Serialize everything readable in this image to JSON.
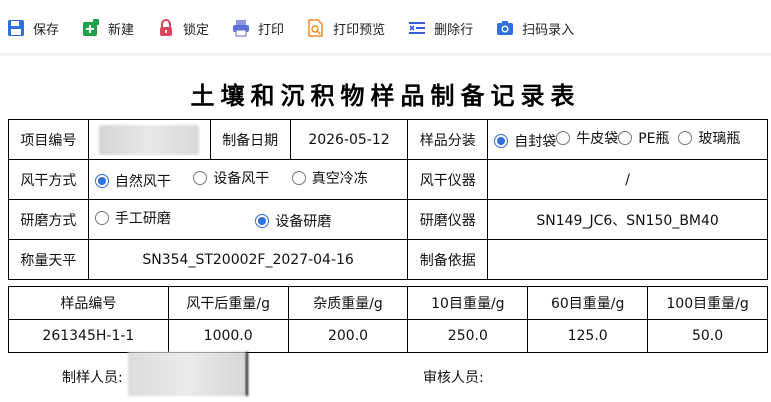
{
  "toolbar": {
    "items": [
      {
        "label": "保存",
        "icon": "save-icon",
        "color": "#2f6fdf"
      },
      {
        "label": "新建",
        "icon": "new-icon",
        "color": "#1fa34a"
      },
      {
        "label": "锁定",
        "icon": "lock-icon",
        "color": "#e0445a"
      },
      {
        "label": "打印",
        "icon": "print-icon",
        "color": "#5b6fd8"
      },
      {
        "label": "打印预览",
        "icon": "print-preview-icon",
        "color": "#f08a24"
      },
      {
        "label": "删除行",
        "icon": "delete-row-icon",
        "color": "#3b5bdb"
      },
      {
        "label": "扫码录入",
        "icon": "scan-icon",
        "color": "#2f6fdf"
      }
    ]
  },
  "title": "土壤和沉积物样品制备记录表",
  "info": {
    "project_no_label": "项目编号",
    "prep_date_label": "制备日期",
    "prep_date": "2026-05-12",
    "pack_label": "样品分装",
    "pack_options": [
      "自封袋",
      "牛皮袋",
      "PE瓶",
      "玻璃瓶"
    ],
    "pack_selected": "自封袋",
    "dry_method_label": "风干方式",
    "dry_options": [
      "自然风干",
      "设备风干",
      "真空冷冻"
    ],
    "dry_selected": "自然风干",
    "dry_instrument_label": "风干仪器",
    "dry_instrument": "/",
    "grind_method_label": "研磨方式",
    "grind_options": [
      "手工研磨",
      "设备研磨"
    ],
    "grind_selected": "设备研磨",
    "grind_instrument_label": "研磨仪器",
    "grind_instrument": "SN149_JC6、SN150_BM40",
    "balance_label": "称量天平",
    "balance": "SN354_ST20002F_2027-04-16",
    "basis_label": "制备依据",
    "basis": ""
  },
  "samples": {
    "headers": [
      "样品编号",
      "风干后重量/g",
      "杂质重量/g",
      "10目重量/g",
      "60目重量/g",
      "100目重量/g"
    ],
    "rows": [
      [
        "261345H-1-1",
        "1000.0",
        "200.0",
        "250.0",
        "125.0",
        "50.0"
      ]
    ]
  },
  "footer": {
    "preparer_label": "制样人员:",
    "reviewer_label": "审核人员:"
  }
}
